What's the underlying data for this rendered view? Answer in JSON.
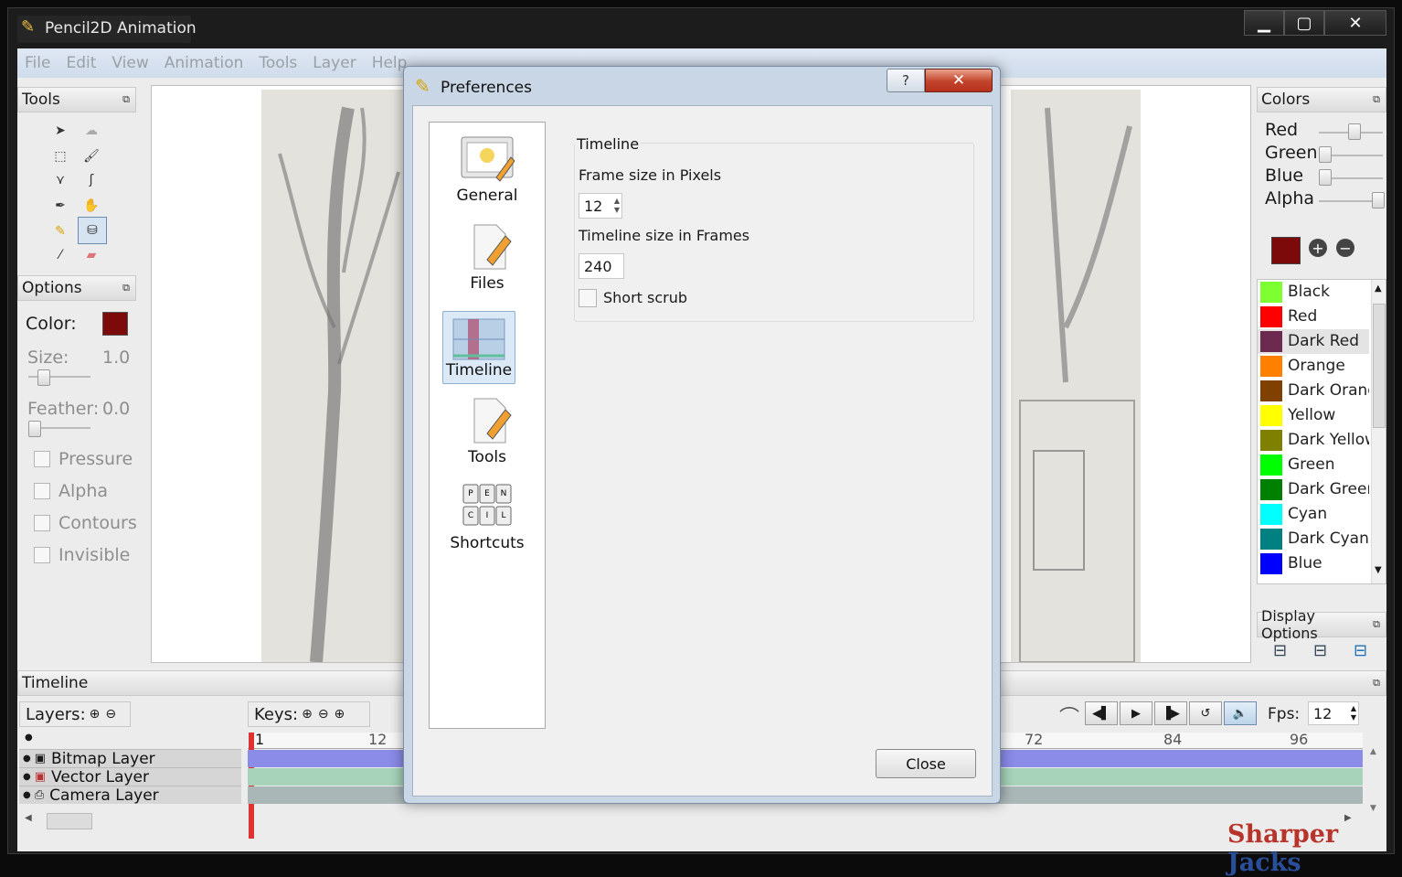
{
  "window": {
    "title": "Pencil2D Animation",
    "controls": [
      "▁",
      "▢",
      "✕"
    ]
  },
  "menu": [
    "File",
    "Edit",
    "View",
    "Animation",
    "Tools",
    "Layer",
    "Help"
  ],
  "tools_panel": {
    "title": "Tools"
  },
  "options_panel": {
    "title": "Options",
    "color_label": "Color:",
    "color": "#7d0a0a",
    "size_label": "Size:",
    "size_value": "1.0",
    "feather_label": "Feather:",
    "feather_value": "0.0",
    "checks": [
      "Pressure",
      "Alpha",
      "Contours",
      "Invisible"
    ]
  },
  "colors_panel": {
    "title": "Colors",
    "sliders": [
      {
        "label": "Red",
        "level": 0.55
      },
      {
        "label": "Green",
        "level": 0.0
      },
      {
        "label": "Blue",
        "level": 0.0
      },
      {
        "label": "Alpha",
        "level": 1.0
      }
    ],
    "current_color": "#7d0a0a",
    "swatches": [
      {
        "name": "Black",
        "color": "#7dff32"
      },
      {
        "name": "Red",
        "color": "#ff0000"
      },
      {
        "name": "Dark Red",
        "color": "#6b2a4e"
      },
      {
        "name": "Orange",
        "color": "#ff8000"
      },
      {
        "name": "Dark Orang",
        "color": "#804000"
      },
      {
        "name": "Yellow",
        "color": "#ffff00"
      },
      {
        "name": "Dark Yellow",
        "color": "#808000"
      },
      {
        "name": "Green",
        "color": "#00ff00"
      },
      {
        "name": "Dark Green",
        "color": "#008000"
      },
      {
        "name": "Cyan",
        "color": "#00ffff"
      },
      {
        "name": "Dark Cyan",
        "color": "#008080"
      },
      {
        "name": "Blue",
        "color": "#0000ff"
      }
    ]
  },
  "display_options": {
    "title": "Display Options"
  },
  "timeline": {
    "title": "Timeline",
    "layers_label": "Layers:",
    "keys_label": "Keys:",
    "fps_label": "Fps:",
    "fps_value": "12",
    "ruler": [
      "1",
      "12",
      "72",
      "84",
      "96"
    ],
    "layers": [
      {
        "name": "Bitmap Layer",
        "color": "#8b8be8"
      },
      {
        "name": "Vector Layer",
        "color": "#a6d3b9"
      },
      {
        "name": "Camera Layer",
        "color": "#a9b7b6"
      }
    ]
  },
  "dialog": {
    "title": "Preferences",
    "help_glyph": "?",
    "close_glyph": "✕",
    "pages": [
      "General",
      "Files",
      "Timeline",
      "Tools",
      "Shortcuts"
    ],
    "selected_page": "Timeline",
    "group_title": "Timeline",
    "frame_size_label": "Frame size in Pixels",
    "frame_size_value": "12",
    "timeline_size_label": "Timeline size in Frames",
    "timeline_size_value": "240",
    "short_scrub_label": "Short scrub",
    "close_button": "Close"
  },
  "watermark": {
    "first": "Sharper",
    "second": "Jacks",
    "first_color": "#b8332a",
    "second_color": "#2a4f9a"
  }
}
